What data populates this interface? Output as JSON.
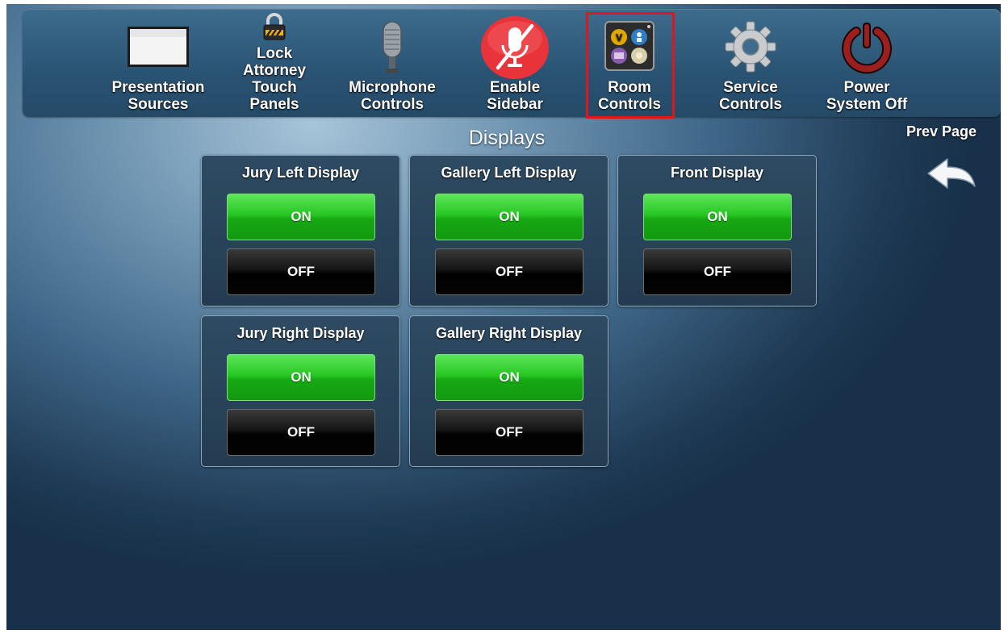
{
  "nav": {
    "items": [
      {
        "id": "presentation-sources",
        "lines": [
          "Presentation",
          "Sources"
        ],
        "icon": "projection-screen-icon"
      },
      {
        "id": "lock-panels",
        "lines": [
          "Lock",
          "Attorney",
          "Touch",
          "Panels"
        ],
        "icon": "padlock-icon"
      },
      {
        "id": "microphone-controls",
        "lines": [
          "Microphone",
          "Controls"
        ],
        "icon": "microphone-icon"
      },
      {
        "id": "enable-sidebar",
        "lines": [
          "Enable",
          "Sidebar"
        ],
        "icon": "muted-microphone-icon"
      },
      {
        "id": "room-controls",
        "lines": [
          "Room",
          "Controls"
        ],
        "icon": "room-controls-icon",
        "selected": true
      },
      {
        "id": "service-controls",
        "lines": [
          "Service",
          "Controls"
        ],
        "icon": "gear-icon"
      },
      {
        "id": "power-system-off",
        "lines": [
          "Power",
          "System Off"
        ],
        "icon": "power-icon"
      }
    ],
    "selected_border_color": "#e0161b"
  },
  "section_title": "Displays",
  "prev_page": {
    "label": "Prev Page",
    "icon": "back-arrow-icon"
  },
  "displays": [
    {
      "title": "Jury Left Display",
      "on_label": "ON",
      "off_label": "OFF"
    },
    {
      "title": "Gallery Left Display",
      "on_label": "ON",
      "off_label": "OFF"
    },
    {
      "title": "Front Display",
      "on_label": "ON",
      "off_label": "OFF"
    },
    {
      "title": "Jury Right Display",
      "on_label": "ON",
      "off_label": "OFF"
    },
    {
      "title": "Gallery Right Display",
      "on_label": "ON",
      "off_label": "OFF"
    }
  ],
  "colors": {
    "on_button": "#22b51f",
    "off_button": "#0a0a0a",
    "panel": "#2a4459"
  }
}
